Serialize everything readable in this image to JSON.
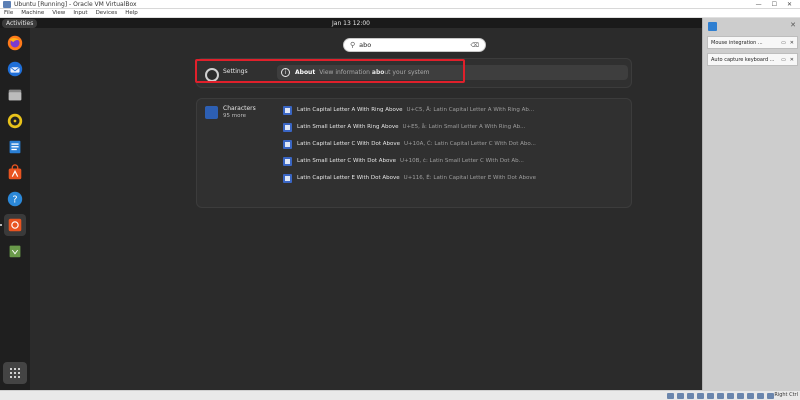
{
  "host": {
    "window_title": "Ubuntu [Running] - Oracle VM VirtualBox",
    "window_buttons": [
      "—",
      "☐",
      "✕"
    ],
    "menu": [
      "File",
      "Machine",
      "View",
      "Input",
      "Devices",
      "Help"
    ],
    "host_key": "Right Ctrl"
  },
  "guest": {
    "activities": "Activities",
    "clock": "Jan 13  12:00",
    "search": {
      "value": "abo",
      "clear_glyph": "⌫"
    },
    "settings_result": {
      "provider": "Settings",
      "item_title": "About",
      "item_desc_before": "View information ",
      "item_desc_match": "abo",
      "item_desc_after": "ut your system"
    },
    "characters_result": {
      "provider": "Characters",
      "more": "95 more",
      "items": [
        {
          "name": "Latin Capital Letter A With Ring Above",
          "detail": "U+C5, Å: Latin Capital Letter A With Ring Ab..."
        },
        {
          "name": "Latin Small Letter A With Ring Above",
          "detail": "U+E5, å: Latin Small Letter A With Ring Ab..."
        },
        {
          "name": "Latin Capital Letter C With Dot Above",
          "detail": "U+10A, Ċ: Latin Capital Letter C With Dot Abo..."
        },
        {
          "name": "Latin Small Letter C With Dot Above",
          "detail": "U+10B, ċ: Latin Small Letter C With Dot Ab..."
        },
        {
          "name": "Latin Capital Letter E With Dot Above",
          "detail": "U+116, Ė: Latin Capital Letter E With Dot Above"
        }
      ]
    },
    "dock": [
      "firefox-icon",
      "thunderbird-icon",
      "files-icon",
      "rhythmbox-icon",
      "libreoffice-writer-icon",
      "app-center-icon",
      "help-icon",
      "ubuntu-software-icon",
      "trash-icon"
    ]
  },
  "sidepane": {
    "notifications": [
      {
        "text": "Mouse integration ..."
      },
      {
        "text": "Auto capture keyboard ..."
      }
    ]
  },
  "colors": {
    "highlight": "#e0202b",
    "guest_bg": "#2b2b2b",
    "panel": "#303030"
  }
}
